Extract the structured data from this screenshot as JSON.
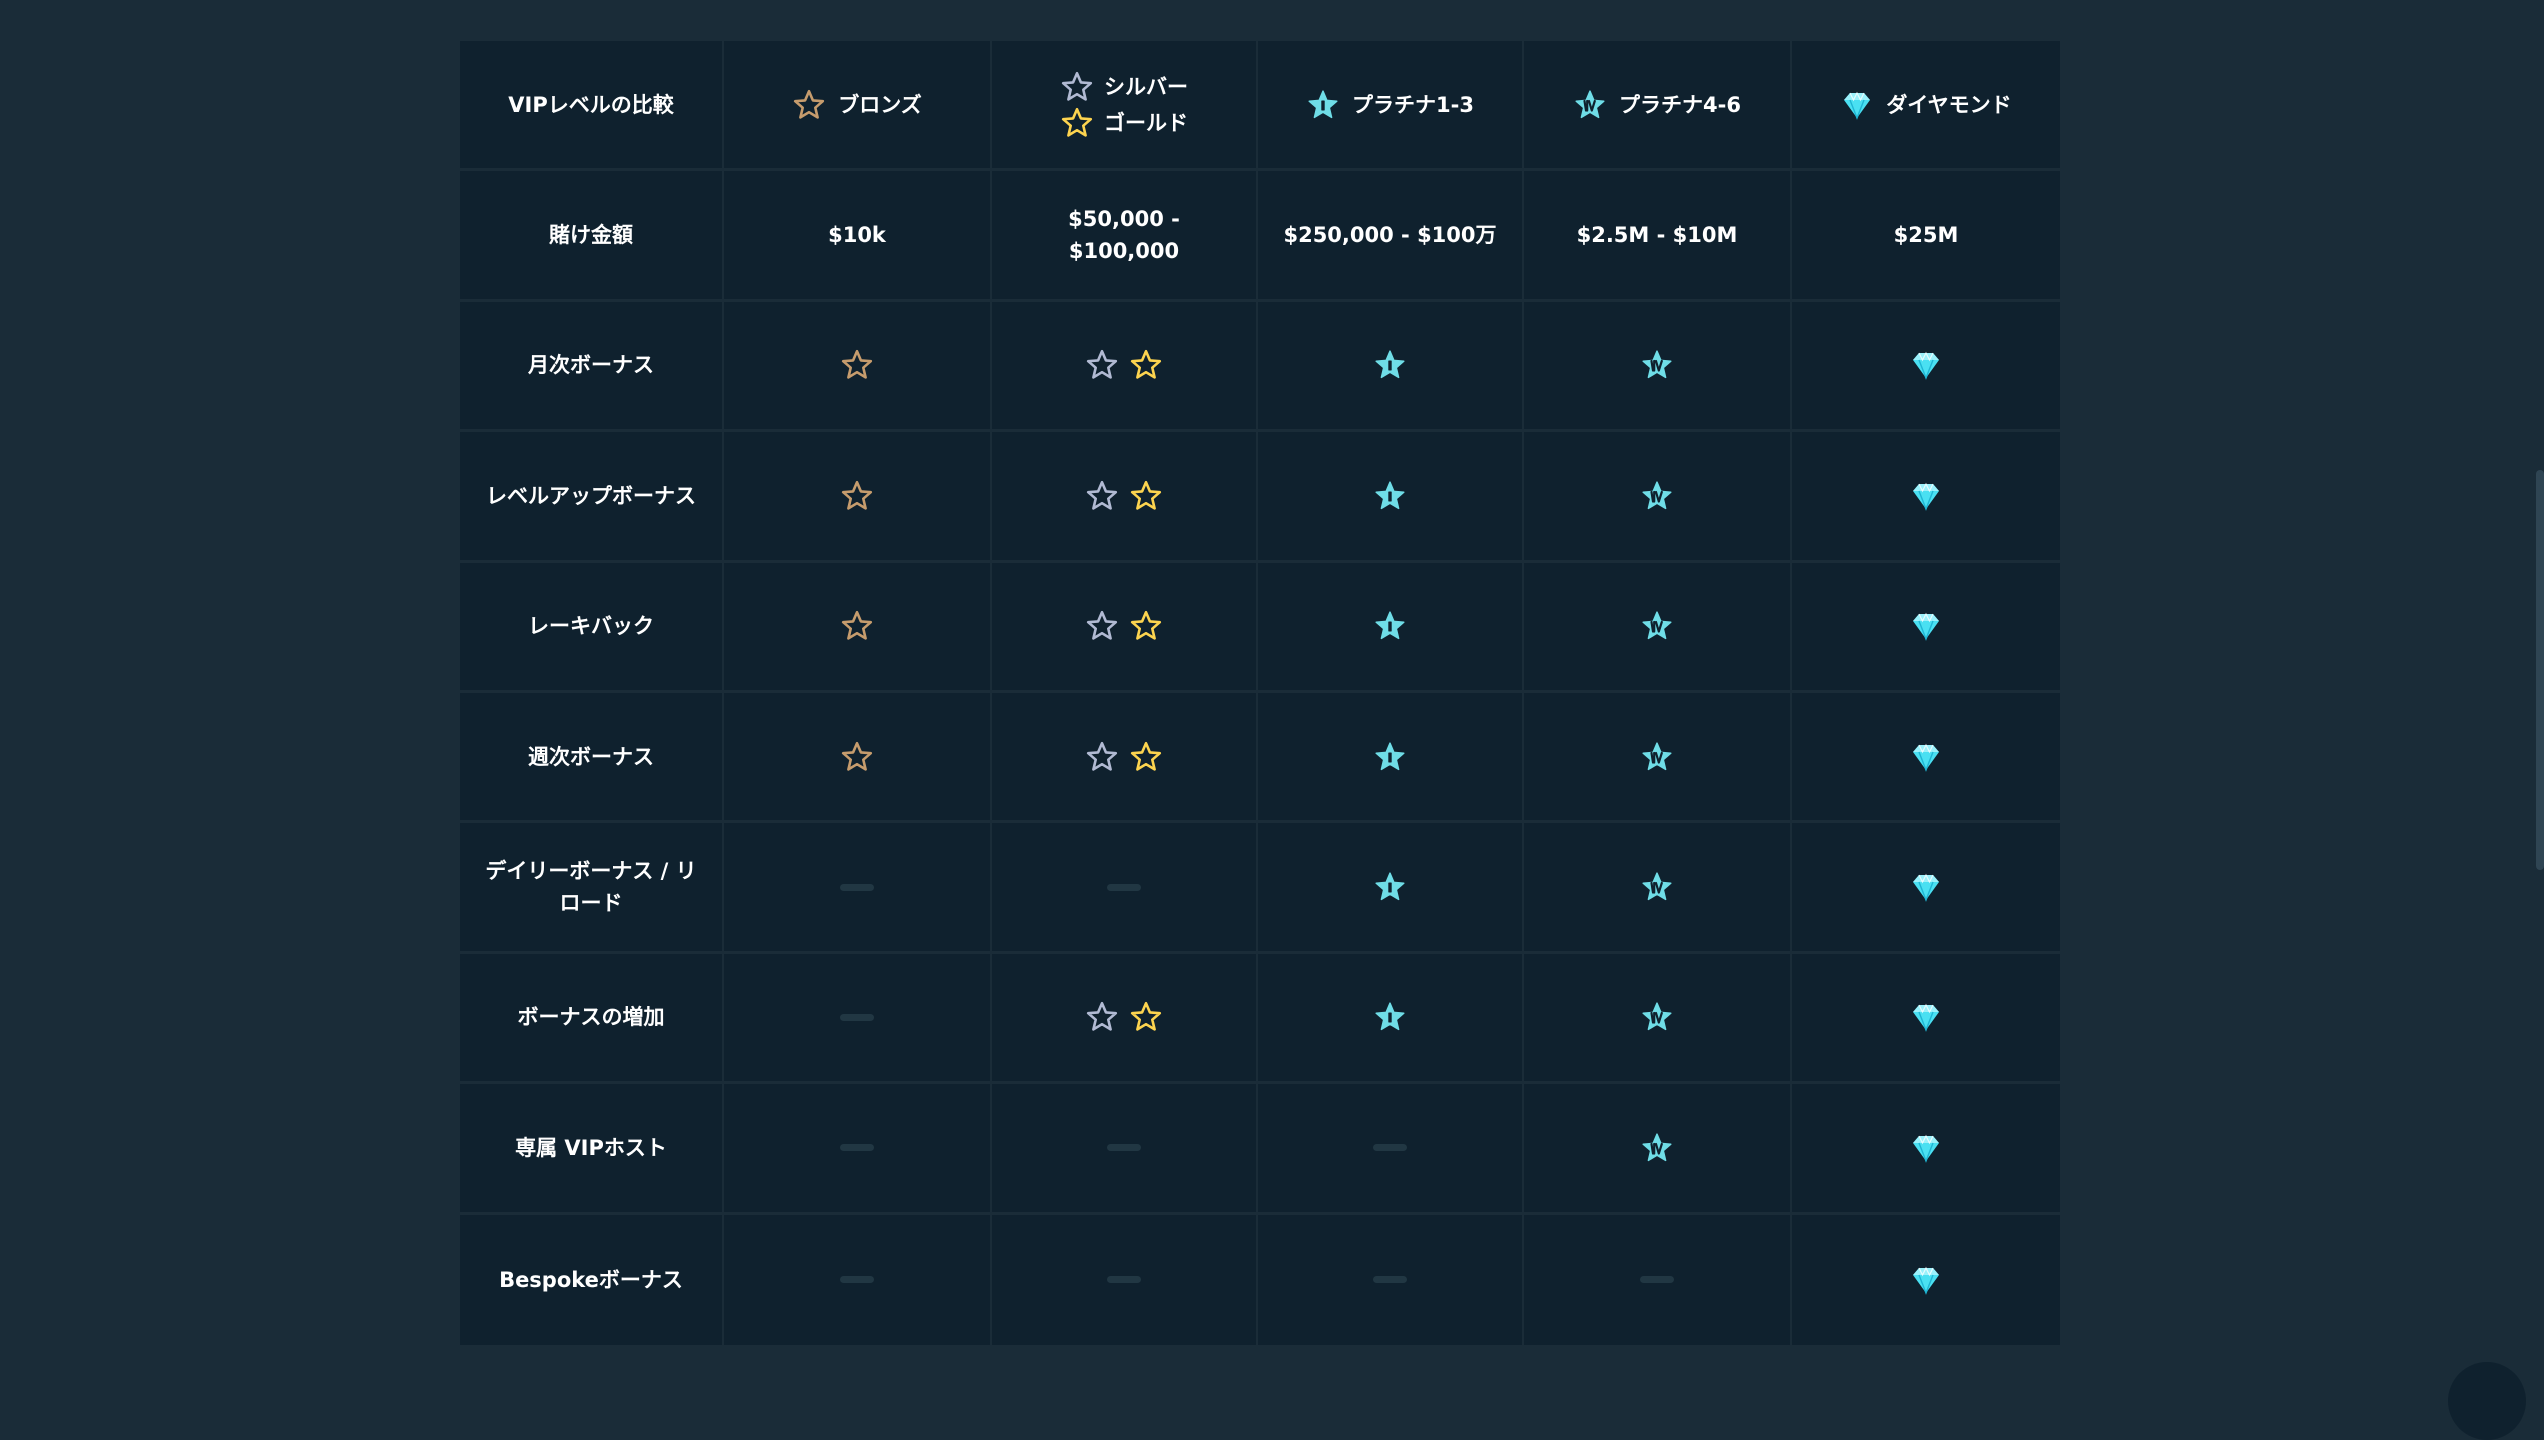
{
  "header": {
    "compare_label": "VIPレベルの比較",
    "tiers": [
      {
        "label": "ブロンズ",
        "icon": "bronze-star-icon"
      },
      {
        "lines": [
          {
            "label": "シルバー",
            "icon": "silver-star-icon"
          },
          {
            "label": "ゴールド",
            "icon": "gold-star-icon"
          }
        ]
      },
      {
        "label": "プラチナ1-3",
        "icon": "platinum-1-star-icon"
      },
      {
        "label": "プラチナ4-6",
        "icon": "platinum-4-star-icon"
      },
      {
        "label": "ダイヤモンド",
        "icon": "diamond-icon"
      }
    ]
  },
  "wager_row": {
    "label": "賭け金額",
    "values": [
      "$10k",
      "$50,000 - $100,000",
      "$250,000 - $100万",
      "$2.5M - $10M",
      "$25M"
    ]
  },
  "feature_rows": [
    {
      "label": "月次ボーナス",
      "availability": [
        true,
        true,
        true,
        true,
        true
      ]
    },
    {
      "label": "レベルアップボーナス",
      "availability": [
        true,
        true,
        true,
        true,
        true
      ]
    },
    {
      "label": "レーキバック",
      "availability": [
        true,
        true,
        true,
        true,
        true
      ]
    },
    {
      "label": "週次ボーナス",
      "availability": [
        true,
        true,
        true,
        true,
        true
      ]
    },
    {
      "label": "デイリーボーナス / リロード",
      "availability": [
        false,
        false,
        true,
        true,
        true
      ]
    },
    {
      "label": "ボーナスの増加",
      "availability": [
        false,
        true,
        true,
        true,
        true
      ]
    },
    {
      "label": "専属 VIPホスト",
      "availability": [
        false,
        false,
        false,
        true,
        true
      ]
    },
    {
      "label": "Bespokeボーナス",
      "availability": [
        false,
        false,
        false,
        false,
        true
      ]
    }
  ],
  "colors": {
    "page_bg": "#1a2c38",
    "table_bg": "#0f212e",
    "bronze": "#c69c6d",
    "silver": "#b1bad3",
    "gold": "#fdd44f",
    "platinum": "#6fdde7",
    "diamond": "#4ae0f2",
    "dash": "#213743"
  }
}
